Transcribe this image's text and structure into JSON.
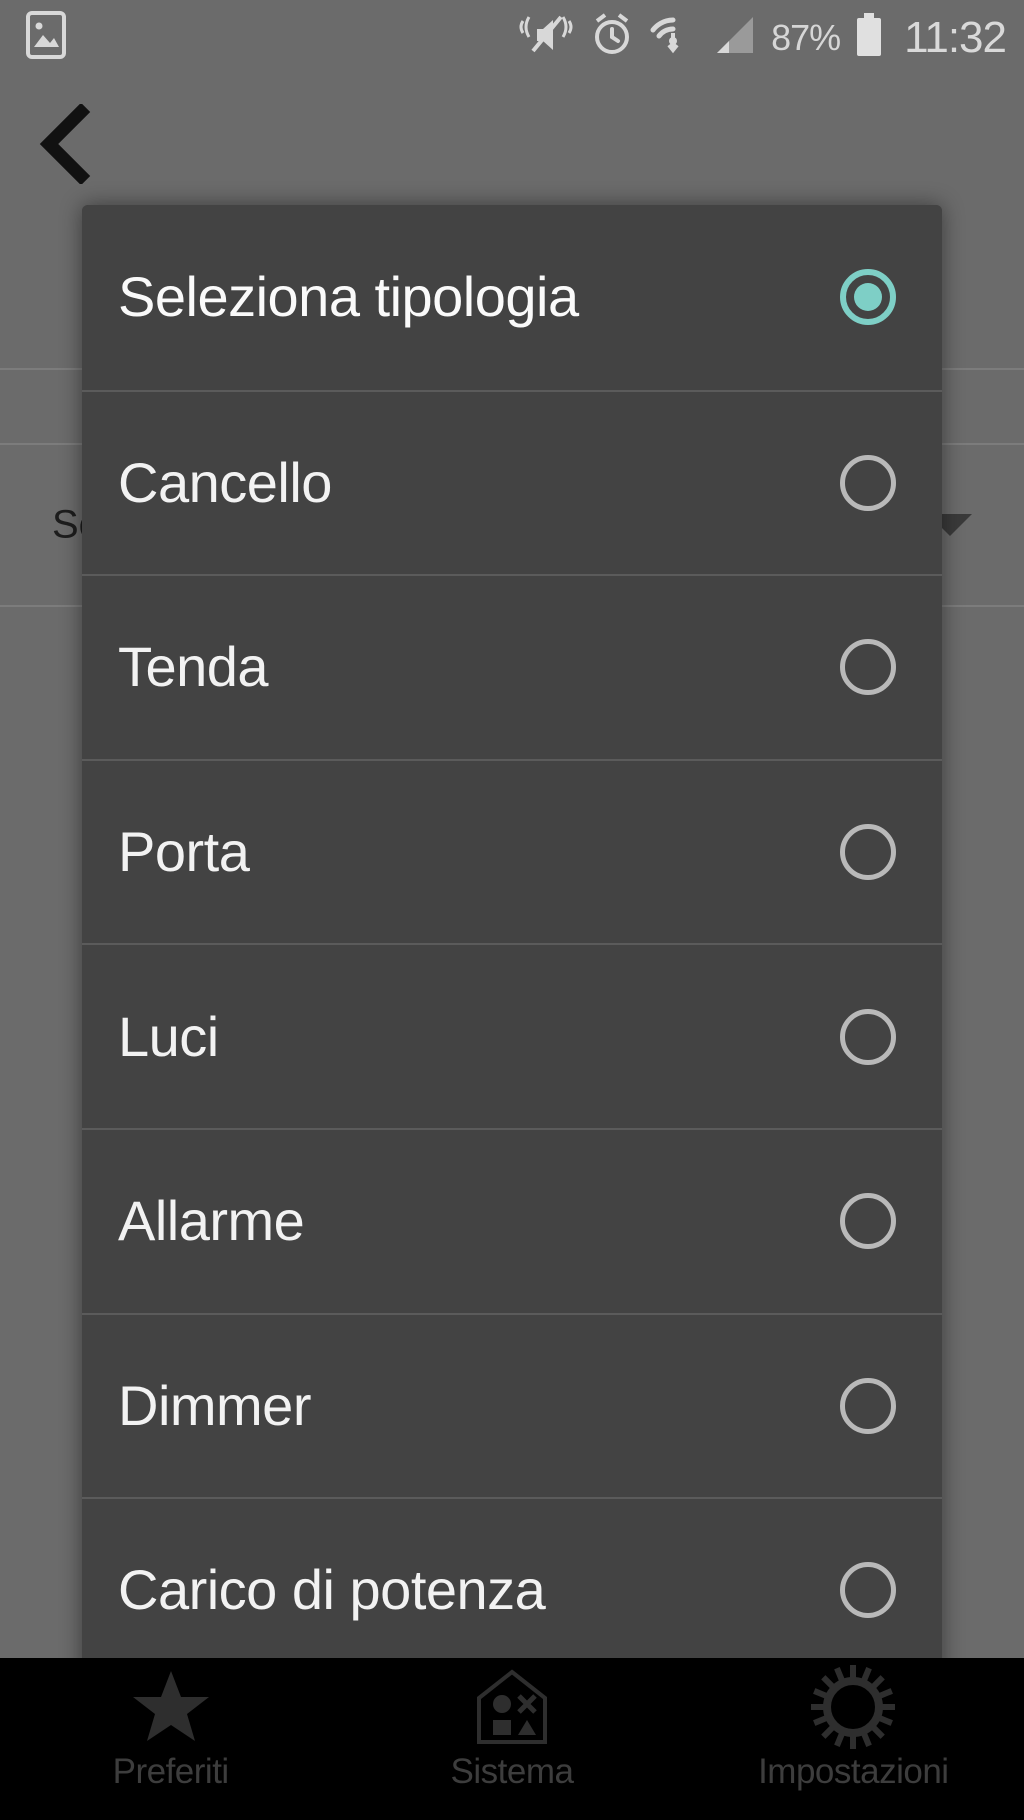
{
  "status_bar": {
    "time": "11:32",
    "battery_percent": "87%",
    "icons": [
      "screenshot-icon",
      "vibrate-mute-icon",
      "alarm-icon",
      "wifi-data-icon",
      "cellular-signal-icon",
      "battery-icon"
    ]
  },
  "background_page": {
    "back_label": "back",
    "field_label": "Se",
    "rows": [
      {
        "label": "",
        "has_caret": false
      },
      {
        "label": "Se",
        "has_caret": true
      },
      {
        "label": "",
        "has_caret": false
      }
    ]
  },
  "dialog": {
    "title": "Seleziona tipologia",
    "items": [
      {
        "label": "Seleziona tipologia",
        "selected": true
      },
      {
        "label": "Cancello",
        "selected": false
      },
      {
        "label": "Tenda",
        "selected": false
      },
      {
        "label": "Porta",
        "selected": false
      },
      {
        "label": "Luci",
        "selected": false
      },
      {
        "label": "Allarme",
        "selected": false
      },
      {
        "label": "Dimmer",
        "selected": false
      },
      {
        "label": "Carico di potenza",
        "selected": false
      }
    ]
  },
  "bottom_nav": {
    "items": [
      {
        "label": "Preferiti",
        "icon": "star-icon"
      },
      {
        "label": "Sistema",
        "icon": "house-shapes-icon"
      },
      {
        "label": "Impostazioni",
        "icon": "gear-icon"
      }
    ]
  },
  "colors": {
    "accent_teal": "#7ecfc6",
    "dialog_bg": "#434343",
    "scrim": "#6b6b6b",
    "nav_bg": "#000000",
    "radio_off": "#b9b9b9"
  }
}
